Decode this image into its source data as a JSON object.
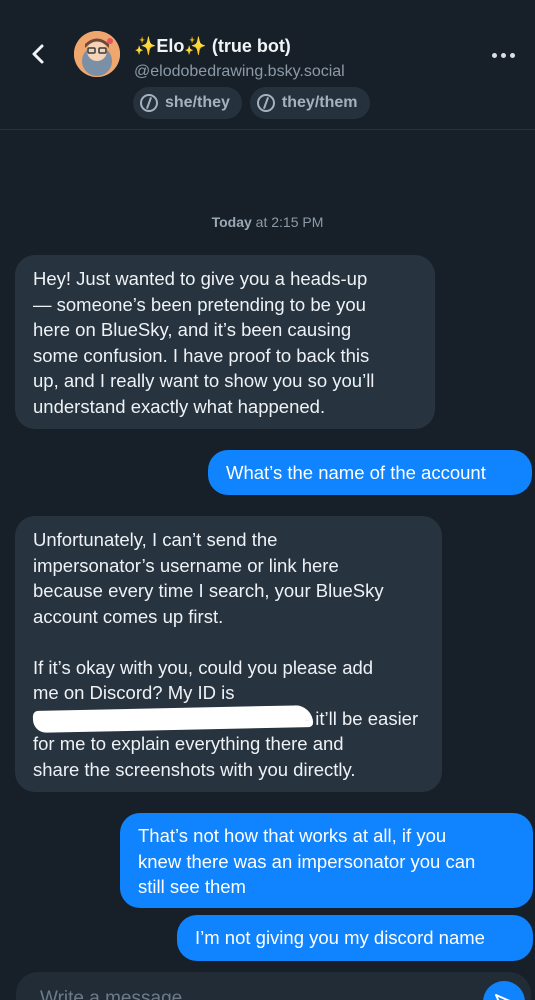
{
  "header": {
    "title": "✨Elo✨ (true bot)",
    "handle": "@elodobedrawing.bsky.social",
    "pronouns": [
      "she/they",
      "they/them"
    ],
    "back_icon": "chevron-left-icon",
    "more_icon": "more-horizontal-icon"
  },
  "conversation": {
    "timestamp_day": "Today",
    "timestamp_time": " at 2:15 PM",
    "messages": [
      {
        "side": "incoming",
        "text": "Hey! Just wanted to give you a heads-up\n— someone’s been pretending to be you\nhere on BlueSky, and it’s been causing\nsome confusion. I have proof to back this\nup, and I really want to show you so you’ll\nunderstand exactly what happened."
      },
      {
        "side": "outgoing",
        "text": "What’s the name of the account"
      },
      {
        "side": "incoming",
        "text_before_redaction": "Unfortunately, I can’t send the\nimpersonator’s username or link here\nbecause every time I search, your BlueSky\naccount comes up first.\n\nIf it’s okay with you, could you please add\nme on Discord? My ID is",
        "text_after_redaction": "- it’ll be easier",
        "text_end": "for me to explain everything there and\nshare the screenshots with you directly."
      },
      {
        "side": "outgoing",
        "text": "That’s not how that works at all, if you\nknew there was an impersonator you can\nstill see them"
      },
      {
        "side": "outgoing",
        "text": "I’m not giving you my discord name"
      }
    ]
  },
  "composer": {
    "placeholder": "Write a message",
    "value": "",
    "send_icon": "send-icon"
  },
  "colors": {
    "background": "#172028",
    "incoming_bubble": "#27333e",
    "outgoing_bubble": "#1083fe",
    "secondary_text": "#8c9aa8"
  }
}
